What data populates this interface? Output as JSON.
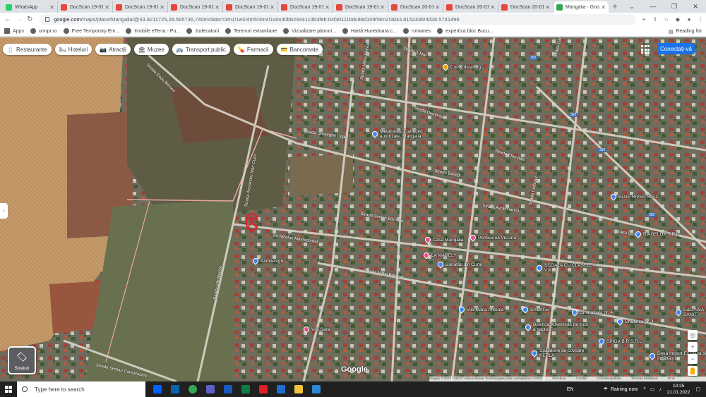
{
  "tabs": [
    {
      "title": "WhatsApp",
      "color": "#25d366",
      "active": false
    },
    {
      "title": "DocScan 19-01",
      "color": "#e8453c",
      "active": false
    },
    {
      "title": "DocScan 19-01",
      "color": "#e8453c",
      "active": false
    },
    {
      "title": "DocScan 19-01",
      "color": "#e8453c",
      "active": false
    },
    {
      "title": "DocScan 19-01",
      "color": "#e8453c",
      "active": false
    },
    {
      "title": "DocScan 19-01",
      "color": "#e8453c",
      "active": false
    },
    {
      "title": "DocScan 19-01",
      "color": "#e8453c",
      "active": false
    },
    {
      "title": "DocScan 20-01",
      "color": "#e8453c",
      "active": false
    },
    {
      "title": "DocScan 20-01",
      "color": "#e8453c",
      "active": false
    },
    {
      "title": "DocScan 20-01",
      "color": "#e8453c",
      "active": false
    },
    {
      "title": "Mangalia - Goo",
      "color": "#34a853",
      "active": true
    }
  ],
  "browser": {
    "new_tab": "+",
    "url_host": "google.com",
    "url_path": "/maps/place/Mangalia/@43.8211725,28.565736,740m/data=!3m1!1e3!4m5!3m4!1s0x40bb29441c3b3feb:0xf30111bdc89d109f!8m2!3d43.8152436!4d28.5741496"
  },
  "bookmarks": [
    {
      "label": "Apps"
    },
    {
      "label": "unnpr.ro"
    },
    {
      "label": "Free Temporary Em..."
    },
    {
      "label": "Imobile eTerra - Pu..."
    },
    {
      "label": "Judecatorii"
    },
    {
      "label": "Terenuri extravilane"
    },
    {
      "label": "Vizualizare planuri..."
    },
    {
      "label": "Hartă Hunedoara c..."
    },
    {
      "label": "romanes"
    },
    {
      "label": "expertiza bloc Bucu..."
    }
  ],
  "reading_list": "Reading list",
  "chips": [
    {
      "label": "Restaurante",
      "icon": "fork-knife-icon",
      "glyph": "🍴"
    },
    {
      "label": "Hoteluri",
      "icon": "bed-icon",
      "glyph": "🛏"
    },
    {
      "label": "Atracții",
      "icon": "camera-icon",
      "glyph": "📷"
    },
    {
      "label": "Muzee",
      "icon": "museum-icon",
      "glyph": "🏛"
    },
    {
      "label": "Transport public",
      "icon": "bus-icon",
      "glyph": "🚌"
    },
    {
      "label": "Farmacii",
      "icon": "pharmacy-icon",
      "glyph": "💊"
    },
    {
      "label": "Bancomate",
      "icon": "atm-icon",
      "glyph": "💳"
    }
  ],
  "sign_in": "Conectați-vă",
  "layers_label": "Straturi",
  "google_logo": "Google",
  "attribution": [
    "Imagini ©2022 CNES / Airbus,Maxar Technologies,Date cartografice ©2022",
    "România",
    "Condiții",
    "Confidențialitate",
    "Trimiteți feedback",
    "50 m"
  ],
  "streets": [
    {
      "name": "Strada 1 Mai"
    },
    {
      "name": "Strada Mihai Viteazu"
    },
    {
      "name": "Strada Dumbravei"
    },
    {
      "name": "Strada Gheorghe Doja"
    },
    {
      "name": "Strada Eternității"
    },
    {
      "name": "Strada Avram Iancu"
    },
    {
      "name": "Strada Bucegi"
    },
    {
      "name": "Strada Cerbului"
    },
    {
      "name": "Strada Școlii"
    },
    {
      "name": "Strada Gării"
    },
    {
      "name": "Str Nicolae Mavrocordat"
    },
    {
      "name": "Strada Matei Basarab"
    },
    {
      "name": "Strada Șerban Cantacuzino"
    },
    {
      "name": "Strada Simion Bărnuțiu"
    },
    {
      "name": "Strada Radu Mihnea"
    },
    {
      "name": "Strada Alexandru Ioan Cuza"
    },
    {
      "name": "Strada Vânătorilor"
    }
  ],
  "route_badges": [
    "392",
    "392",
    "392",
    "392"
  ],
  "places": [
    {
      "name": "Comy detailing",
      "color": "#f29900"
    },
    {
      "name": "Metafrasis, Traduceri autorizate, Mangalia",
      "color": "#4285f4"
    },
    {
      "name": "BLUE RIVER S.R.L",
      "color": "#4285f4"
    },
    {
      "name": "BIAGELUX S.R.L",
      "color": "#4285f4"
    },
    {
      "name": "Casa Mangalia",
      "color": "#ea4d8f"
    },
    {
      "name": "Pensiunea Victoria",
      "color": "#ea4d8f"
    },
    {
      "name": "LA MARELY",
      "color": "#ea4d8f"
    },
    {
      "name": "Bunătăți din Curte",
      "color": "#4285f4"
    },
    {
      "name": "Andidesign",
      "color": "#4285f4"
    },
    {
      "name": "ȘCOALA CU CLASELE I-VIII",
      "color": "#4285f4"
    },
    {
      "name": "Vila Maria Antonia",
      "color": "#4285f4"
    },
    {
      "name": "SmartFix",
      "color": "#4285f4"
    },
    {
      "name": "Biserica Adventistă de ziua a șaptea",
      "color": "#4285f4"
    },
    {
      "name": "Spălătorie de covoare PERLA",
      "color": "#4285f4"
    },
    {
      "name": "Vila Sara",
      "color": "#ea4d8f"
    },
    {
      "name": "Gimnaziala nr. 4",
      "color": "#4285f4"
    },
    {
      "name": "Grădinița nr. 4",
      "color": "#4285f4"
    },
    {
      "name": "SPIGA B R S.R.L",
      "color": "#4285f4"
    },
    {
      "name": "D&G NSA SANIT",
      "color": "#4285f4"
    },
    {
      "name": "Deka Import-Ex plasa si încălțămi",
      "color": "#4285f4"
    }
  ],
  "taskbar": {
    "search_placeholder": "Type here to search",
    "apps": [
      {
        "name": "dropbox",
        "color": "#0061fe"
      },
      {
        "name": "outlook",
        "color": "#0a64ad"
      },
      {
        "name": "chrome",
        "color": "#34a853"
      },
      {
        "name": "teams",
        "color": "#5b5fc7"
      },
      {
        "name": "word",
        "color": "#185abd"
      },
      {
        "name": "excel",
        "color": "#107c41"
      },
      {
        "name": "acrobat",
        "color": "#e31e24"
      },
      {
        "name": "app",
        "color": "#1f6fd1"
      },
      {
        "name": "folder",
        "color": "#f3c43e"
      },
      {
        "name": "app2",
        "color": "#2b88d8"
      }
    ],
    "language": "EN",
    "weather": "Raining now",
    "time": "10:25",
    "date": "21.01.2022"
  }
}
